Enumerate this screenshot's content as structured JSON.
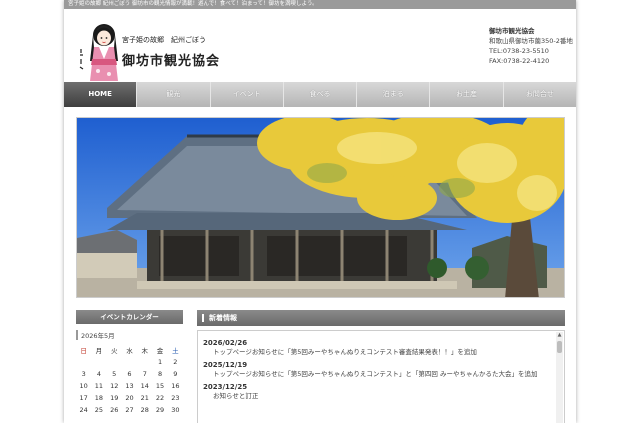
{
  "topbar": {
    "text": "宮子姫の故郷 紀州ごぼう 御坊市の観光情報が満載！遊んで！食べて！泊まって！御坊を満喫しよう。"
  },
  "header": {
    "tagline": "宮子姫の故郷　紀州ごぼう",
    "title": "御坊市観光協会",
    "contact": {
      "org": "御坊市観光協会",
      "address": "和歌山県御坊市薗350-2番地",
      "tel": "TEL:0738-23-5510",
      "fax": "FAX:0738-22-4120"
    }
  },
  "nav": {
    "items": [
      {
        "label": "HOME"
      },
      {
        "label": "観光"
      },
      {
        "label": "イベント"
      },
      {
        "label": "食べる"
      },
      {
        "label": "泊まる"
      },
      {
        "label": "お土産"
      },
      {
        "label": "お問合せ"
      }
    ]
  },
  "calendar": {
    "title": "イベントカレンダー",
    "month": "2026年5月",
    "weekdays": [
      "日",
      "月",
      "火",
      "水",
      "木",
      "金",
      "土"
    ],
    "weeks": [
      [
        "",
        "",
        "",
        "",
        "",
        "1",
        "2"
      ],
      [
        "3",
        "4",
        "5",
        "6",
        "7",
        "8",
        "9"
      ],
      [
        "10",
        "11",
        "12",
        "13",
        "14",
        "15",
        "16"
      ],
      [
        "17",
        "18",
        "19",
        "20",
        "21",
        "22",
        "23"
      ],
      [
        "24",
        "25",
        "26",
        "27",
        "28",
        "29",
        "30"
      ]
    ]
  },
  "news": {
    "title": "新着情報",
    "items": [
      {
        "date": "2026/02/26",
        "text": "トップページお知らせに「第5回みーやちゃんぬりえコンテスト審査結果発表！！」を追加"
      },
      {
        "date": "2025/12/19",
        "text": "トップページお知らせに「第5回みーやちゃんぬりえコンテスト」と「第四回 みーやちゃんかるた大会」を追加"
      },
      {
        "date": "2023/12/25",
        "text": "お知らせと訂正"
      }
    ]
  },
  "colors": {
    "nav_active": "#4a4a4a",
    "nav_bg": "#c4c4c4",
    "sunday": "#c0392b",
    "saturday": "#2a5db0"
  }
}
